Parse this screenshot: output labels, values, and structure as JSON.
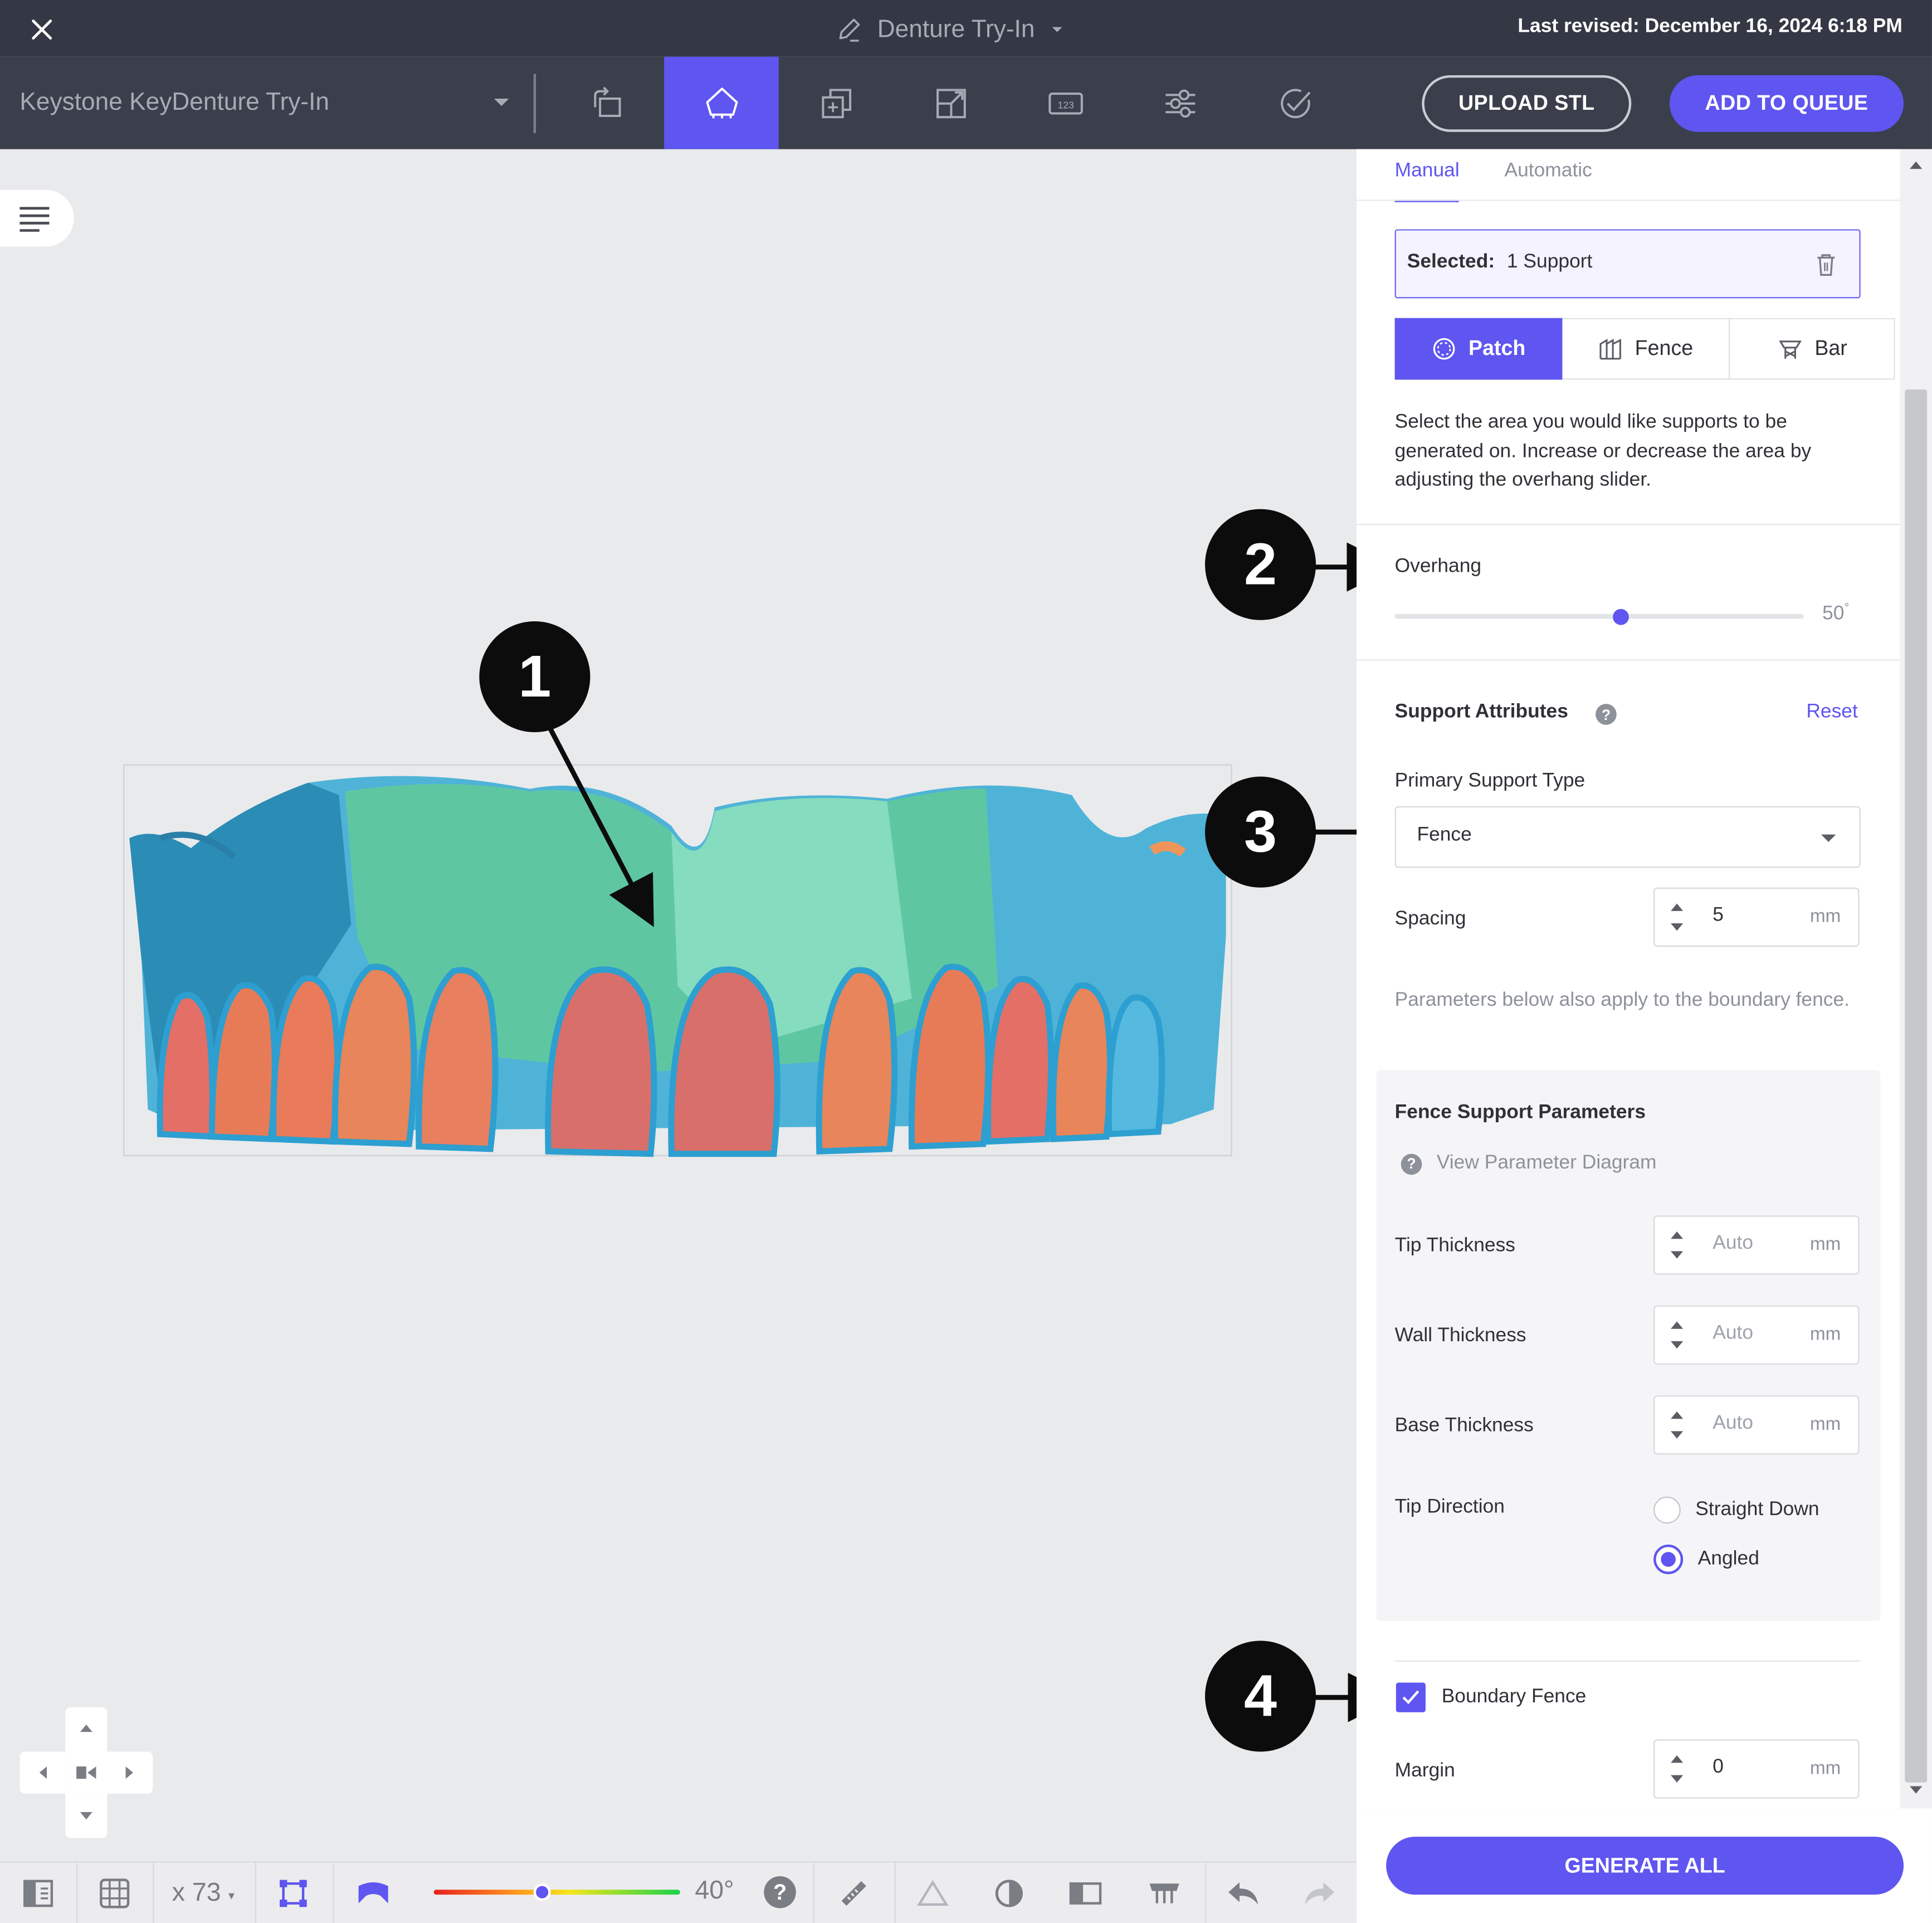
{
  "app": {
    "close_icon": "close-icon",
    "title": "Denture Try-In",
    "last_revised": "Last revised: December 16, 2024 6:18 PM"
  },
  "toolbar": {
    "material": "Keystone KeyDenture Try-In",
    "tools": [
      "orient-icon",
      "supports-icon",
      "duplicate-icon",
      "scale-icon",
      "label-icon",
      "adjust-icon",
      "validate-icon"
    ],
    "upload_label": "UPLOAD STL",
    "queue_label": "ADD TO QUEUE",
    "accent": "#5f55f0"
  },
  "panel": {
    "tabs": [
      "Manual",
      "Automatic"
    ],
    "selected_prefix": "Selected:",
    "selected_value": "1 Support",
    "type_buttons": [
      "Patch",
      "Fence",
      "Bar"
    ],
    "help_text": "Select the area you would like supports to be generated on. Increase or decrease the area by adjusting the overhang slider.",
    "overhang_label": "Overhang",
    "overhang_value": "50",
    "overhang_unit": "°",
    "overhang_fraction": 0.55,
    "attributes_title": "Support Attributes",
    "reset_label": "Reset",
    "primary_type_label": "Primary Support Type",
    "primary_type_value": "Fence",
    "spacing_label": "Spacing",
    "spacing_value": "5",
    "unit_mm": "mm",
    "boundary_note": "Parameters below also apply to the boundary fence.",
    "fence_params_title": "Fence Support Parameters",
    "view_diagram_label": "View Parameter Diagram",
    "tip_thickness_label": "Tip Thickness",
    "wall_thickness_label": "Wall Thickness",
    "base_thickness_label": "Base Thickness",
    "auto_value": "Auto",
    "tip_direction_label": "Tip Direction",
    "tip_direction_options": [
      "Straight Down",
      "Angled"
    ],
    "tip_direction_selected": "Angled",
    "boundary_fence_label": "Boundary Fence",
    "boundary_fence_checked": true,
    "margin_label": "Margin",
    "margin_value": "0",
    "generate_label": "GENERATE ALL"
  },
  "viewport": {
    "callouts": [
      "1",
      "2",
      "3",
      "4"
    ]
  },
  "bottombar": {
    "count_label": "x 73",
    "angle_label": "40°",
    "angle_fraction": 0.44
  }
}
